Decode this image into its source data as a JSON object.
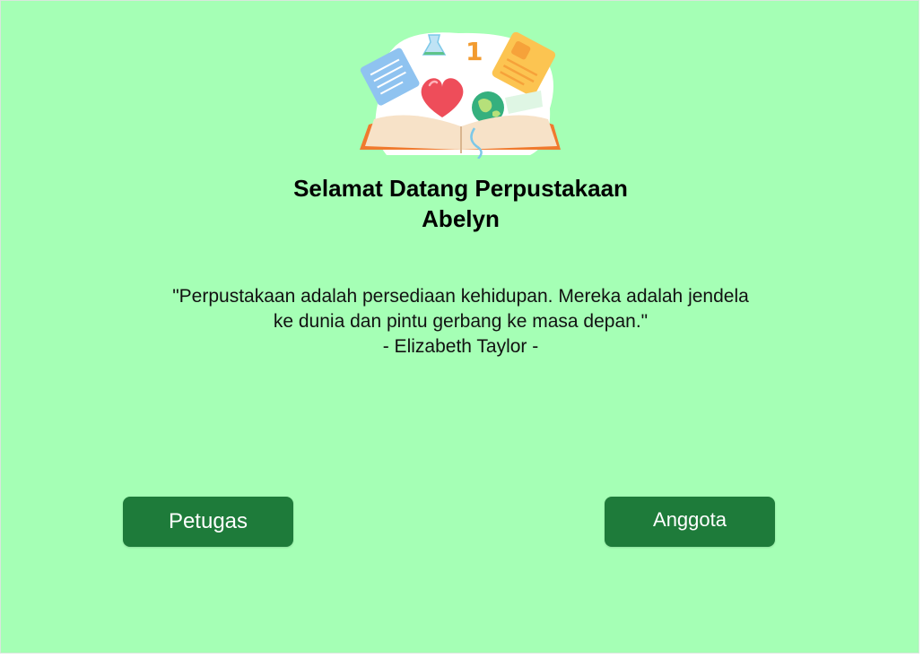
{
  "header": {
    "title_line1": "Selamat Datang Perpustakaan",
    "title_line2": "Abelyn"
  },
  "quote": {
    "line1": "\"Perpustakaan adalah persediaan kehidupan. Mereka adalah jendela",
    "line2": "ke dunia dan pintu gerbang ke masa depan.\"",
    "author": "- Elizabeth Taylor -"
  },
  "actions": {
    "petugas_label": "Petugas",
    "anggota_label": "Anggota"
  },
  "illustration": {
    "icon": "library-books-icon",
    "number_glyph": "1"
  },
  "colors": {
    "background": "#a5ffb5",
    "button": "#1e7b3a",
    "button_text": "#ffffff"
  }
}
